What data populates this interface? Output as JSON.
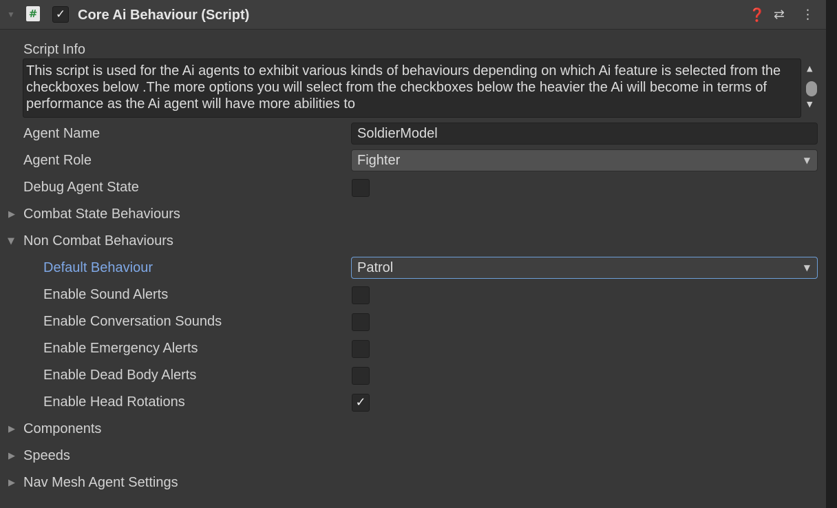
{
  "header": {
    "title": "Core Ai Behaviour (Script)",
    "enabled": true,
    "icons": [
      "script-icon",
      "help-icon",
      "presets-icon",
      "kebab-menu-icon"
    ],
    "script_icon_glyph": "#",
    "check_glyph": "✓",
    "help_glyph": "❓",
    "presets_glyph": "⇄",
    "menu_glyph": "⋮"
  },
  "script_info": {
    "label": "Script Info",
    "text": "This script is used for the Ai agents to exhibit various kinds of behaviours depending on which Ai feature is selected from the checkboxes below .The more options you will select from the checkboxes below the heavier the Ai will become in terms of performance as the Ai agent will have more abilities to"
  },
  "fields": {
    "agent_name": {
      "label": "Agent Name",
      "value": "SoldierModel"
    },
    "agent_role": {
      "label": "Agent Role",
      "value": "Fighter"
    },
    "debug_agent_state": {
      "label": "Debug Agent State",
      "checked": false
    }
  },
  "sections": {
    "combat_state": {
      "label": "Combat State Behaviours",
      "expanded": false
    },
    "non_combat": {
      "label": "Non Combat Behaviours",
      "expanded": true,
      "default_behaviour": {
        "label": "Default Behaviour",
        "value": "Patrol"
      },
      "toggles": [
        {
          "label": "Enable Sound Alerts",
          "checked": false
        },
        {
          "label": "Enable Conversation Sounds",
          "checked": false
        },
        {
          "label": "Enable Emergency Alerts",
          "checked": false
        },
        {
          "label": "Enable Dead Body Alerts",
          "checked": false
        },
        {
          "label": "Enable Head Rotations",
          "checked": true
        }
      ]
    },
    "components": {
      "label": "Components",
      "expanded": false
    },
    "speeds": {
      "label": "Speeds",
      "expanded": false
    },
    "nav_mesh": {
      "label": "Nav Mesh Agent Settings",
      "expanded": false
    }
  },
  "glyphs": {
    "collapsed": "▶",
    "expanded": "▼",
    "dropdown_arrow": "▼",
    "check": "✓",
    "scroll_up": "▲",
    "scroll_down": "▼"
  },
  "colors": {
    "background": "#383838",
    "field": "#2a2a2a",
    "accent_label": "#7fa8e6",
    "focus_border": "#6e9fd8"
  }
}
